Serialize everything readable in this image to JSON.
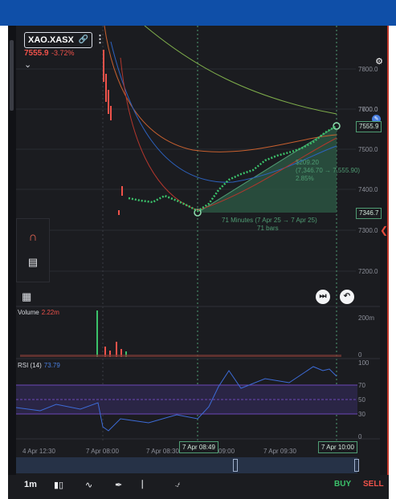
{
  "symbol": {
    "name": "XAO.XASX",
    "price": "7555.9",
    "change": "-3.72%"
  },
  "price_axis": {
    "ticks": [
      "7800.0",
      "7700.0",
      "7600.0",
      "7500.0",
      "7400.0",
      "7300.0",
      "7200.0"
    ],
    "current_tag": "7555.9",
    "start_tag": "7346.7"
  },
  "measure": {
    "change": "$209.20",
    "range": "(7,346.70 → 7,555.90)",
    "percent": "2.85%",
    "duration": "71 Minutes (7 Apr 25 → 7 Apr 25)",
    "bars": "71 bars"
  },
  "volume": {
    "label": "Volume",
    "value": "2.22m",
    "tick_top": "200m",
    "tick_zero": "0"
  },
  "rsi": {
    "label": "RSI (14)",
    "value": "73.79",
    "ticks": [
      "100",
      "70",
      "50",
      "30",
      "0"
    ]
  },
  "time_axis": {
    "labels": [
      "4 Apr 12:30",
      "7 Apr 08:00",
      "7 Apr 08:30",
      "09:00",
      "7 Apr 09:30"
    ],
    "cursor_tag": "7 Apr 08:49",
    "end_tag": "7 Apr 10:00"
  },
  "bottom_bar": {
    "interval": "1m",
    "buy": "BUY",
    "sell": "SELL"
  },
  "colors": {
    "up": "#3bc16a",
    "down": "#f0524a",
    "accent": "#4f9c73",
    "top_bar": "#0f4fa8"
  },
  "icons": [
    "link-icon",
    "kebab-menu-icon",
    "chevron-down-icon",
    "settings-icon",
    "edit-icon",
    "magnet-icon",
    "trash-icon",
    "calendar-icon",
    "skip-forward-icon",
    "undo-icon",
    "candlestick-icon",
    "indicators-icon",
    "brush-icon",
    "ruler-icon",
    "alert-bell-icon"
  ]
}
